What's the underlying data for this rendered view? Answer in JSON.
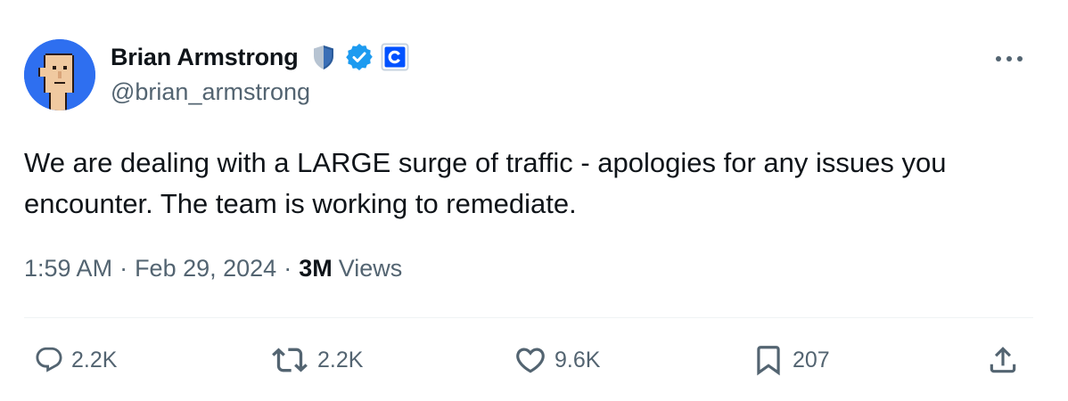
{
  "author": {
    "display_name": "Brian Armstrong",
    "handle": "@brian_armstrong",
    "avatar_bg": "#2e6ff0",
    "badges": [
      "shield-badge",
      "verified-badge",
      "coinbase-affiliate-badge"
    ]
  },
  "tweet": {
    "text": "We are dealing with a LARGE surge of traffic - apologies for any issues you encounter. The team is working to remediate.",
    "time": "1:59 AM",
    "date": "Feb 29, 2024",
    "separator": "·",
    "views_count": "3M",
    "views_label": "Views"
  },
  "actions": {
    "replies": "2.2K",
    "retweets": "2.2K",
    "likes": "9.6K",
    "bookmarks": "207"
  },
  "icons": {
    "reply": "reply-icon",
    "retweet": "retweet-icon",
    "like": "heart-icon",
    "bookmark": "bookmark-icon",
    "share": "share-icon",
    "more": "more-icon"
  },
  "colors": {
    "verified_blue": "#1d9bf0",
    "coinbase_blue": "#0052ff",
    "text_primary": "#0f1419",
    "text_secondary": "#536471"
  }
}
